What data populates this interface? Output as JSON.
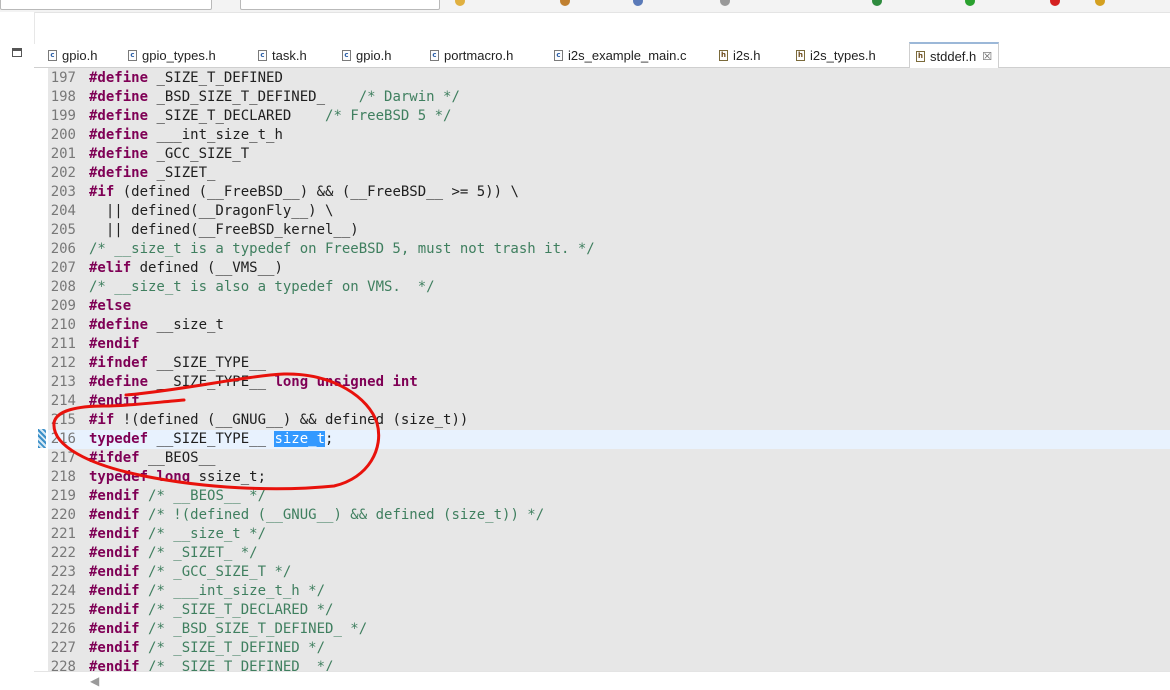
{
  "tabs": [
    {
      "label": "gpio.h",
      "icon": "c-header-file-icon",
      "kind": "c"
    },
    {
      "label": "gpio_types.h",
      "icon": "c-header-file-icon",
      "kind": "c"
    },
    {
      "label": "task.h",
      "icon": "c-header-file-icon",
      "kind": "c"
    },
    {
      "label": "gpio.h",
      "icon": "c-header-file-icon",
      "kind": "c"
    },
    {
      "label": "portmacro.h",
      "icon": "c-header-file-icon",
      "kind": "c"
    },
    {
      "label": "i2s_example_main.c",
      "icon": "c-source-file-icon",
      "kind": "c"
    },
    {
      "label": "i2s.h",
      "icon": "h-header-file-icon",
      "kind": "h"
    },
    {
      "label": "i2s_types.h",
      "icon": "h-header-file-icon",
      "kind": "h"
    },
    {
      "label": "stddef.h",
      "icon": "h-header-file-icon",
      "kind": "h",
      "active": true,
      "close_glyph": "☒"
    }
  ],
  "editor": {
    "current_line": "216",
    "selected_text": "size_t",
    "lines": [
      {
        "n": "197",
        "parts": [
          {
            "t": "#define",
            "c": "kw"
          },
          {
            "t": " _SIZE_T_DEFINED"
          }
        ]
      },
      {
        "n": "198",
        "parts": [
          {
            "t": "#define",
            "c": "kw"
          },
          {
            "t": " _BSD_SIZE_T_DEFINED_    "
          },
          {
            "t": "/* Darwin */",
            "c": "cm"
          }
        ]
      },
      {
        "n": "199",
        "parts": [
          {
            "t": "#define",
            "c": "kw"
          },
          {
            "t": " _SIZE_T_DECLARED    "
          },
          {
            "t": "/* FreeBSD 5 */",
            "c": "cm"
          }
        ]
      },
      {
        "n": "200",
        "parts": [
          {
            "t": "#define",
            "c": "kw"
          },
          {
            "t": " ___int_size_t_h"
          }
        ]
      },
      {
        "n": "201",
        "parts": [
          {
            "t": "#define",
            "c": "kw"
          },
          {
            "t": " _GCC_SIZE_T"
          }
        ]
      },
      {
        "n": "202",
        "parts": [
          {
            "t": "#define",
            "c": "kw"
          },
          {
            "t": " _SIZET_"
          }
        ]
      },
      {
        "n": "203",
        "parts": [
          {
            "t": "#if",
            "c": "kw"
          },
          {
            "t": " (defined (__FreeBSD__) && (__FreeBSD__ >= 5)) \\"
          }
        ]
      },
      {
        "n": "204",
        "parts": [
          {
            "t": "  || defined(__DragonFly__) \\"
          }
        ]
      },
      {
        "n": "205",
        "parts": [
          {
            "t": "  || defined(__FreeBSD_kernel__)"
          }
        ]
      },
      {
        "n": "206",
        "parts": [
          {
            "t": "/* __size_t is a typedef on FreeBSD 5, must not trash it. */",
            "c": "cm"
          }
        ]
      },
      {
        "n": "207",
        "parts": [
          {
            "t": "#elif",
            "c": "kw"
          },
          {
            "t": " defined (__VMS__)"
          }
        ]
      },
      {
        "n": "208",
        "parts": [
          {
            "t": "/* __size_t is also a typedef on VMS.  */",
            "c": "cm"
          }
        ]
      },
      {
        "n": "209",
        "parts": [
          {
            "t": "#else",
            "c": "kw"
          }
        ]
      },
      {
        "n": "210",
        "parts": [
          {
            "t": "#define",
            "c": "kw"
          },
          {
            "t": " __size_t"
          }
        ]
      },
      {
        "n": "211",
        "parts": [
          {
            "t": "#endif",
            "c": "kw"
          }
        ]
      },
      {
        "n": "212",
        "parts": [
          {
            "t": "#ifndef",
            "c": "kw"
          },
          {
            "t": " __SIZE_TYPE__"
          }
        ]
      },
      {
        "n": "213",
        "parts": [
          {
            "t": "#define",
            "c": "kw"
          },
          {
            "t": " __SIZE_TYPE__ "
          },
          {
            "t": "long unsigned int",
            "c": "kw"
          }
        ]
      },
      {
        "n": "214",
        "parts": [
          {
            "t": "#endif",
            "c": "kw"
          }
        ]
      },
      {
        "n": "215",
        "parts": [
          {
            "t": "#if",
            "c": "kw"
          },
          {
            "t": " !(defined (__GNUG__) && defined (size_t))"
          }
        ]
      },
      {
        "n": "216",
        "current": true,
        "parts": [
          {
            "t": "typedef",
            "c": "kw"
          },
          {
            "t": " __SIZE_TYPE__ "
          },
          {
            "t": "size_t",
            "c": "sel"
          },
          {
            "t": ";"
          }
        ]
      },
      {
        "n": "217",
        "parts": [
          {
            "t": "#ifdef",
            "c": "kw"
          },
          {
            "t": " __BEOS__"
          }
        ]
      },
      {
        "n": "218",
        "parts": [
          {
            "t": "typedef",
            "c": "kw"
          },
          {
            "t": " "
          },
          {
            "t": "long",
            "c": "kw"
          },
          {
            "t": " ssize_t;"
          }
        ]
      },
      {
        "n": "219",
        "parts": [
          {
            "t": "#endif",
            "c": "kw"
          },
          {
            "t": " "
          },
          {
            "t": "/* __BEOS__ */",
            "c": "cm"
          }
        ]
      },
      {
        "n": "220",
        "parts": [
          {
            "t": "#endif",
            "c": "kw"
          },
          {
            "t": " "
          },
          {
            "t": "/* !(defined (__GNUG__) && defined (size_t)) */",
            "c": "cm"
          }
        ]
      },
      {
        "n": "221",
        "parts": [
          {
            "t": "#endif",
            "c": "kw"
          },
          {
            "t": " "
          },
          {
            "t": "/* __size_t */",
            "c": "cm"
          }
        ]
      },
      {
        "n": "222",
        "parts": [
          {
            "t": "#endif",
            "c": "kw"
          },
          {
            "t": " "
          },
          {
            "t": "/* _SIZET_ */",
            "c": "cm"
          }
        ]
      },
      {
        "n": "223",
        "parts": [
          {
            "t": "#endif",
            "c": "kw"
          },
          {
            "t": " "
          },
          {
            "t": "/* _GCC_SIZE_T */",
            "c": "cm"
          }
        ]
      },
      {
        "n": "224",
        "parts": [
          {
            "t": "#endif",
            "c": "kw"
          },
          {
            "t": " "
          },
          {
            "t": "/* ___int_size_t_h */",
            "c": "cm"
          }
        ]
      },
      {
        "n": "225",
        "parts": [
          {
            "t": "#endif",
            "c": "kw"
          },
          {
            "t": " "
          },
          {
            "t": "/* _SIZE_T_DECLARED */",
            "c": "cm"
          }
        ]
      },
      {
        "n": "226",
        "parts": [
          {
            "t": "#endif",
            "c": "kw"
          },
          {
            "t": " "
          },
          {
            "t": "/* _BSD_SIZE_T_DEFINED_ */",
            "c": "cm"
          }
        ]
      },
      {
        "n": "227",
        "parts": [
          {
            "t": "#endif",
            "c": "kw"
          },
          {
            "t": " "
          },
          {
            "t": "/* _SIZE_T_DEFINED */",
            "c": "cm"
          }
        ]
      },
      {
        "n": "228",
        "parts": [
          {
            "t": "#endif",
            "c": "kw"
          },
          {
            "t": " "
          },
          {
            "t": "/* _SIZE_T_DEFINED_ */",
            "c": "cm"
          }
        ]
      }
    ]
  },
  "colors": {
    "keyword": "#7f0055",
    "comment": "#3f7f5f",
    "selection": "#3399ff",
    "current_line": "#e8f2fe",
    "editor_bg": "#e7e7e7",
    "annotation": "#e8120c"
  },
  "icons": {
    "minimize": "minimize-icon",
    "scroll_left": "◀"
  }
}
